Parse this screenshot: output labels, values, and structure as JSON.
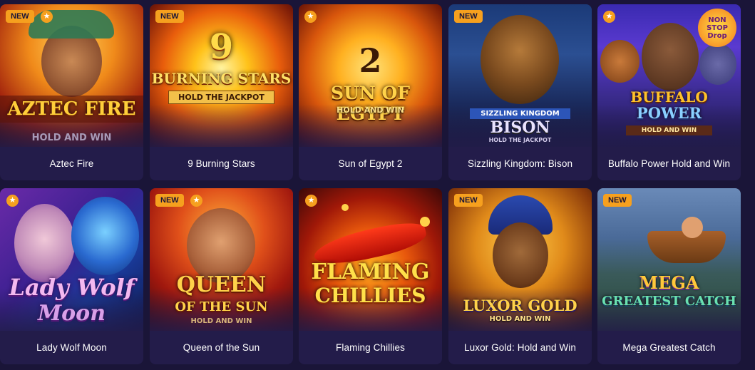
{
  "badges": {
    "new": "NEW",
    "star": "★"
  },
  "games": [
    {
      "name": "Aztec Fire",
      "art_title": "AZTEC FIRE",
      "art_sub": "HOLD AND WIN",
      "new": true,
      "favorite": true
    },
    {
      "name": "9 Burning Stars",
      "art_number": "9",
      "art_title": "BURNING STARS",
      "art_sub": "HOLD THE JACKPOT",
      "new": true,
      "favorite": false
    },
    {
      "name": "Sun of Egypt 2",
      "art_number": "2",
      "art_title": "SUN OF EGYPT",
      "art_sub": "HOLD AND WIN",
      "new": false,
      "favorite": true
    },
    {
      "name": "Sizzling Kingdom: Bison",
      "art_title": "SIZZLING KINGDOM",
      "art_title2": "BISON",
      "art_sub": "HOLD THE JACKPOT",
      "new": true,
      "favorite": false
    },
    {
      "name": "Buffalo Power Hold and Win",
      "art_title": "BUFFALO",
      "art_title2": "POWER",
      "art_sub": "HOLD AND WIN",
      "art_corner": "NON STOP Drop",
      "new": false,
      "favorite": true
    },
    {
      "name": "Lady Wolf Moon",
      "art_title": "Lady Wolf",
      "art_title2": "Moon",
      "new": false,
      "favorite": true
    },
    {
      "name": "Queen of the Sun",
      "art_title": "QUEEN",
      "art_title2": "OF THE SUN",
      "art_sub": "HOLD AND WIN",
      "new": true,
      "favorite": true
    },
    {
      "name": "Flaming Chillies",
      "art_title": "FLAMING",
      "art_title2": "CHILLIES",
      "new": false,
      "favorite": true
    },
    {
      "name": "Luxor Gold: Hold and Win",
      "art_title": "LUXOR GOLD",
      "art_sub": "HOLD AND WIN",
      "new": true,
      "favorite": false
    },
    {
      "name": "Mega Greatest Catch",
      "art_title": "MEGA",
      "art_title2": "GREATEST CATCH",
      "new": true,
      "favorite": false
    }
  ],
  "colors": {
    "page_bg": "#1a1538",
    "card_bg": "#231c4a",
    "badge": "#f6a01e"
  }
}
